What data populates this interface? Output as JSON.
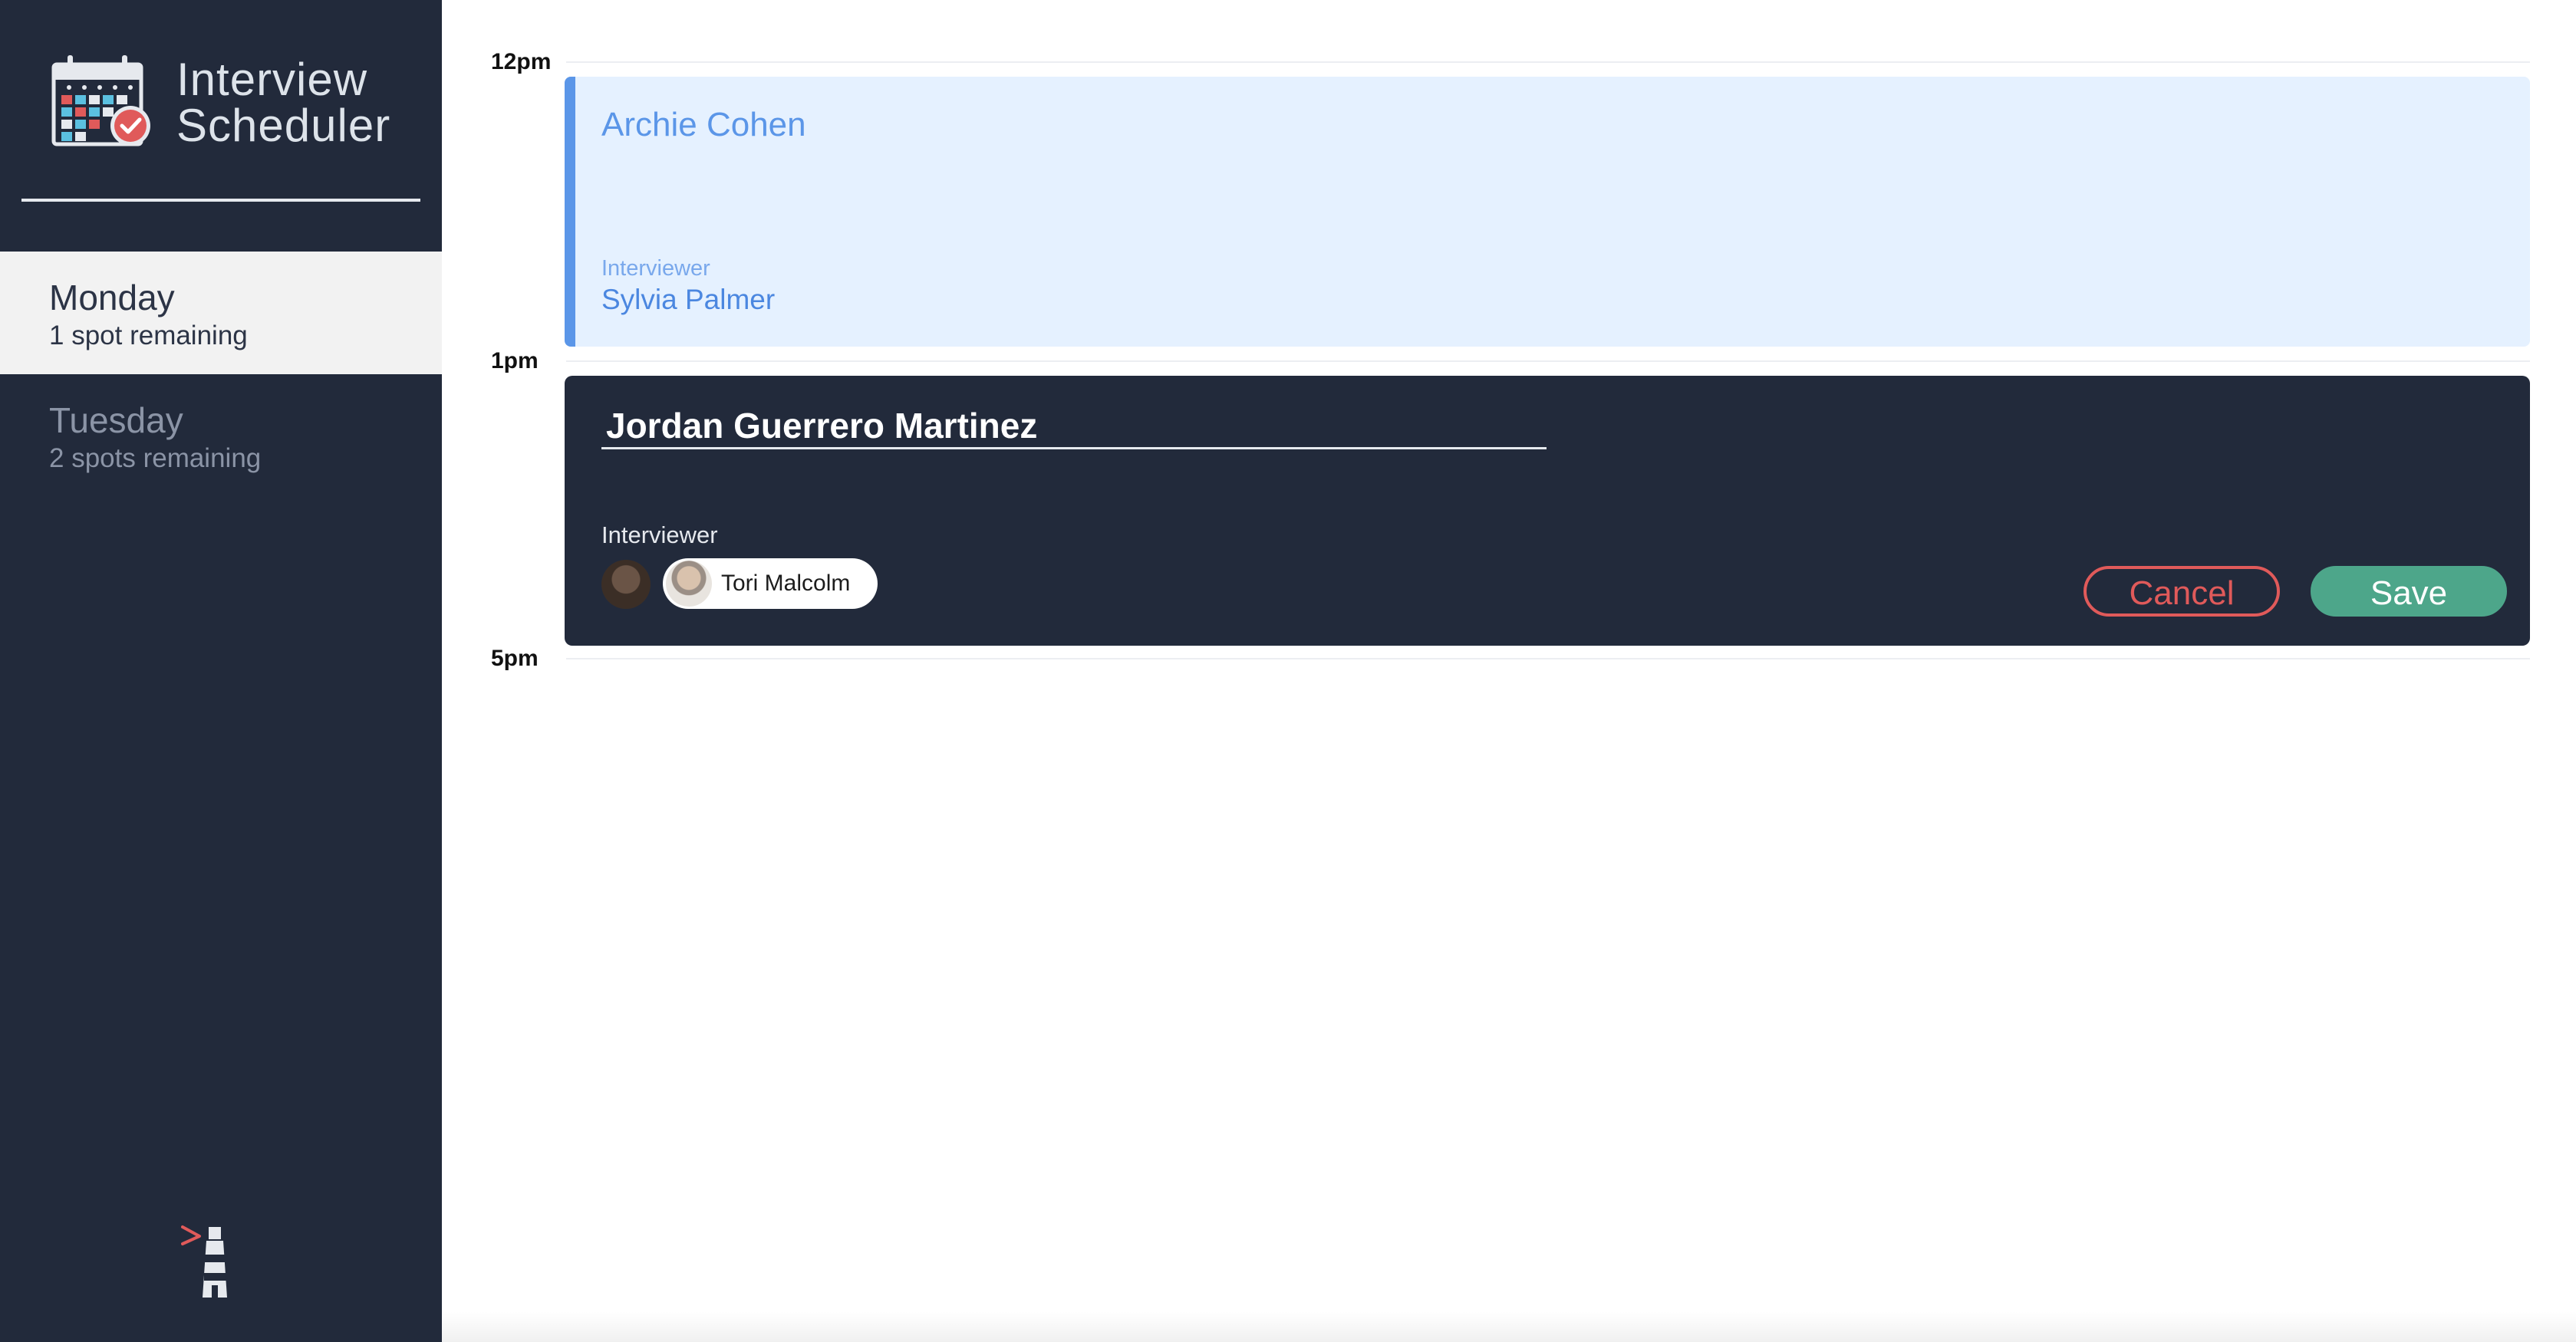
{
  "app": {
    "title_line1": "Interview",
    "title_line2": "Scheduler",
    "accent_color": "#5b96e8"
  },
  "sidebar": {
    "days": [
      {
        "name": "Monday",
        "spots": "1 spot remaining",
        "selected": true
      },
      {
        "name": "Tuesday",
        "spots": "2 spots remaining",
        "selected": false
      }
    ]
  },
  "schedule": {
    "slots": [
      {
        "time": "12pm"
      },
      {
        "time": "1pm"
      },
      {
        "time": "5pm"
      }
    ],
    "appointment_show": {
      "student": "Archie Cohen",
      "interviewer_label": "Interviewer",
      "interviewer": "Sylvia Palmer"
    },
    "appointment_form": {
      "student_value": "Jordan Guerrero Martinez",
      "interviewer_label": "Interviewer",
      "selected_interviewer": "Tori Malcolm",
      "cancel_label": "Cancel",
      "save_label": "Save",
      "cancel_color": "#e05a5a",
      "save_color": "#4da68a"
    }
  }
}
